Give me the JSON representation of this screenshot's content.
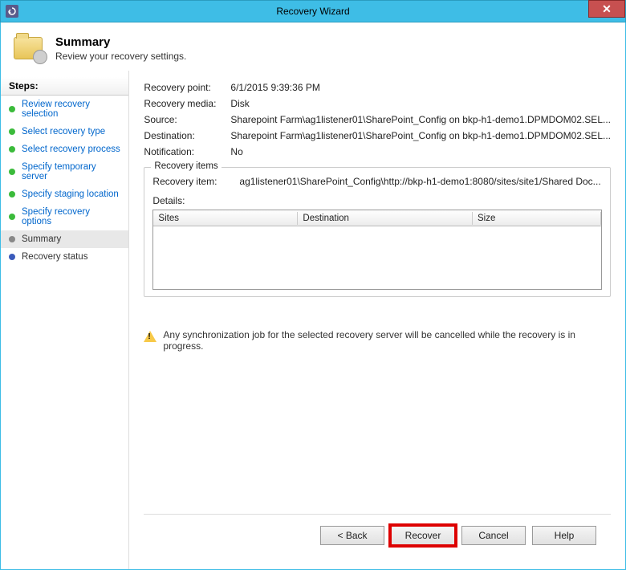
{
  "window": {
    "title": "Recovery Wizard"
  },
  "header": {
    "title": "Summary",
    "subtitle": "Review your recovery settings."
  },
  "sidebar": {
    "title": "Steps:",
    "items": [
      {
        "label": "Review recovery selection",
        "state": "done",
        "link": true
      },
      {
        "label": "Select recovery type",
        "state": "done",
        "link": true
      },
      {
        "label": "Select recovery process",
        "state": "done",
        "link": true
      },
      {
        "label": "Specify temporary server",
        "state": "done",
        "link": true
      },
      {
        "label": "Specify staging location",
        "state": "done",
        "link": true
      },
      {
        "label": "Specify recovery options",
        "state": "done",
        "link": true
      },
      {
        "label": "Summary",
        "state": "current",
        "link": false
      },
      {
        "label": "Recovery status",
        "state": "pending",
        "link": false
      }
    ]
  },
  "summary": {
    "recovery_point_label": "Recovery point:",
    "recovery_point_value": "6/1/2015 9:39:36 PM",
    "recovery_media_label": "Recovery media:",
    "recovery_media_value": "Disk",
    "source_label": "Source:",
    "source_value": "Sharepoint Farm\\ag1listener01\\SharePoint_Config on bkp-h1-demo1.DPMDOM02.SEL...",
    "destination_label": "Destination:",
    "destination_value": "Sharepoint Farm\\ag1listener01\\SharePoint_Config on bkp-h1-demo1.DPMDOM02.SEL...",
    "notification_label": "Notification:",
    "notification_value": "No",
    "recovery_items_title": "Recovery items",
    "recovery_item_label": "Recovery item:",
    "recovery_item_value": "ag1listener01\\SharePoint_Config\\http://bkp-h1-demo1:8080/sites/site1/Shared Doc...",
    "details_label": "Details:",
    "columns": {
      "c1": "Sites",
      "c2": "Destination",
      "c3": "Size"
    },
    "warning": "Any synchronization job for the selected recovery server will be cancelled while the recovery is in progress."
  },
  "buttons": {
    "back": "< Back",
    "recover": "Recover",
    "cancel": "Cancel",
    "help": "Help"
  }
}
